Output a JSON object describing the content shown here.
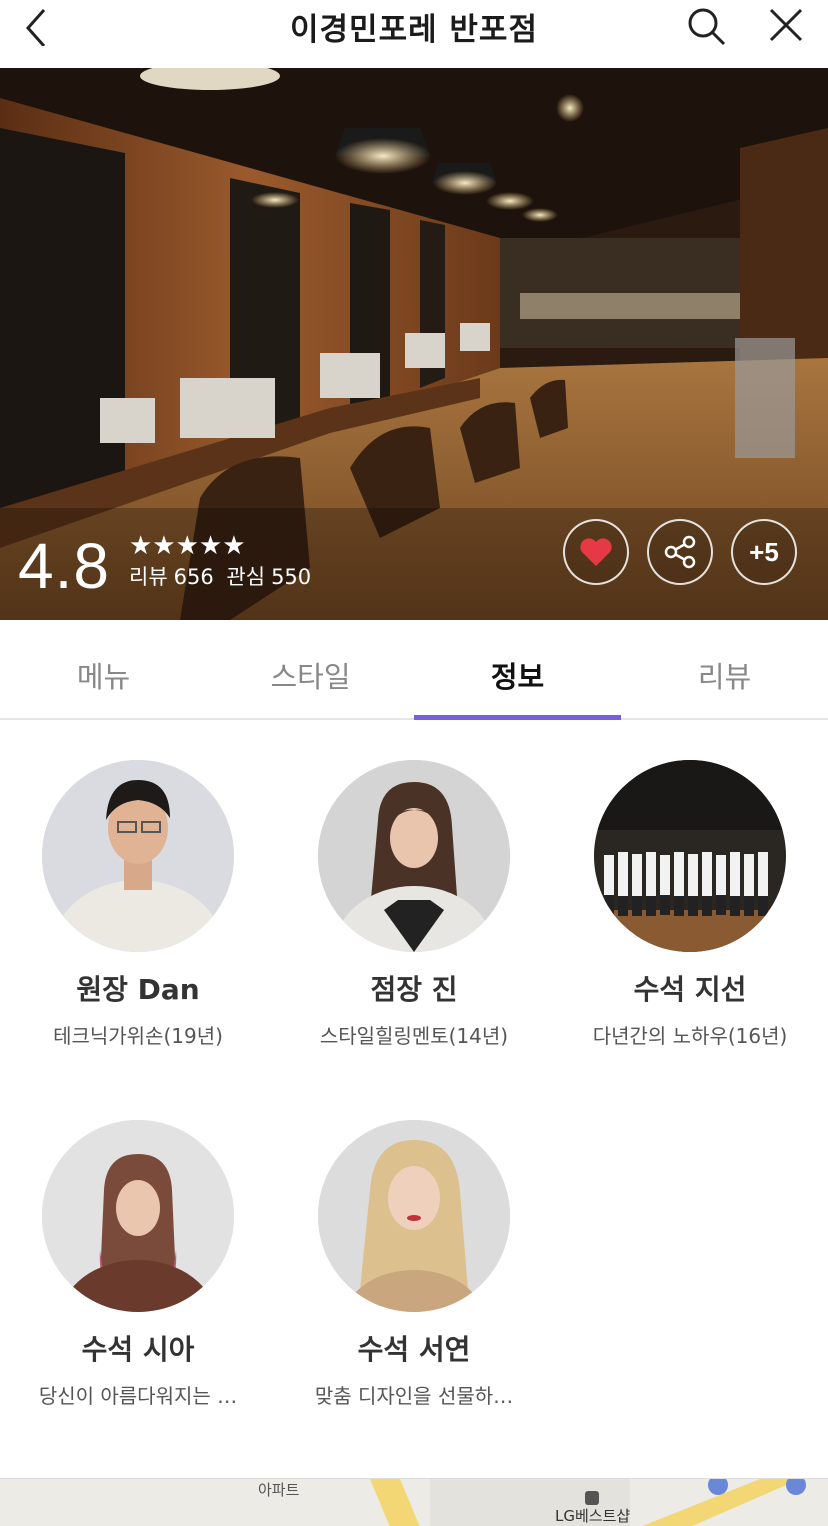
{
  "header": {
    "title": "이경민포레 반포점"
  },
  "hero": {
    "rating": "4.8",
    "stars": "★★★★★",
    "review_label": "리뷰",
    "review_count": "656",
    "interest_label": "관심",
    "interest_count": "550",
    "more_label": "+5",
    "heart_color": "#e53945"
  },
  "tabs": [
    {
      "label": "메뉴"
    },
    {
      "label": "스타일"
    },
    {
      "label": "정보"
    },
    {
      "label": "리뷰"
    }
  ],
  "active_tab": "정보",
  "accent_color": "#7a5ee0",
  "staff": [
    {
      "name": "원장 Dan",
      "desc": "테크닉가위손(19년)"
    },
    {
      "name": "점장 진",
      "desc": "스타일힐링멘토(14년)"
    },
    {
      "name": "수석 지선",
      "desc": "다년간의 노하우(16년)"
    },
    {
      "name": "수석 시아",
      "desc": "당신이 아름다워지는 …"
    },
    {
      "name": "수석 서연",
      "desc": "맞춤 디자인을 선물하…"
    }
  ],
  "map": {
    "label1": "아파트",
    "label2": "LG베스트샵"
  }
}
